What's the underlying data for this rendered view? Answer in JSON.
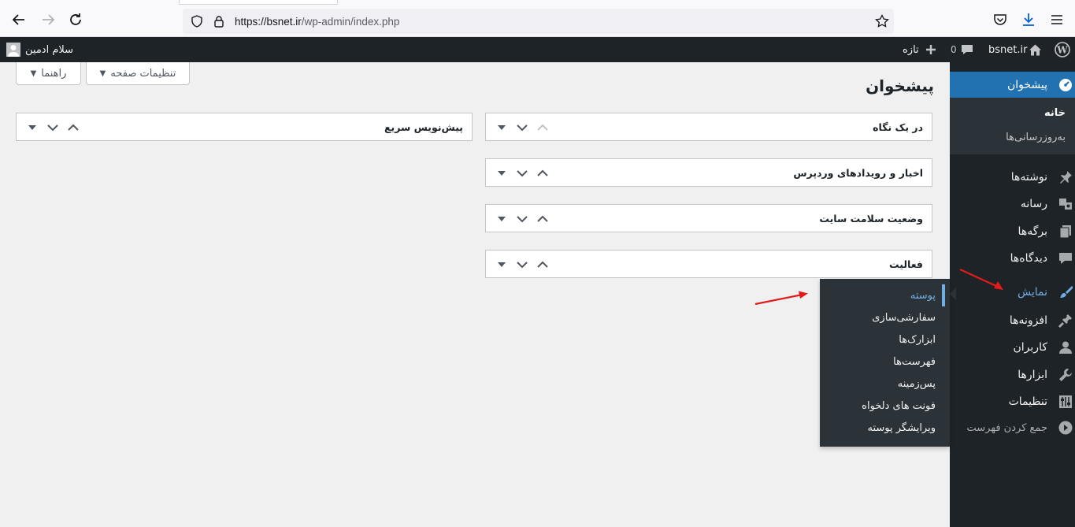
{
  "browser": {
    "url_host": "https://bsnet.ir",
    "url_path": "/wp-admin/index.php"
  },
  "adminbar": {
    "site_name": "bsnet.ir",
    "comments_count": "0",
    "new_label": "تازه",
    "greeting": "سلام ادمین"
  },
  "sidebar": {
    "dashboard_label": "پیشخوان",
    "home_label": "خانه",
    "updates_label": "به‌روزرسانی‌ها",
    "posts_label": "نوشته‌ها",
    "media_label": "رسانه",
    "pages_label": "برگه‌ها",
    "comments_label": "دیدگاه‌ها",
    "appearance_label": "نمایش",
    "plugins_label": "افزونه‌ها",
    "users_label": "کاربران",
    "tools_label": "ابزارها",
    "settings_label": "تنظیمات",
    "collapse_label": "جمع کردن فهرست"
  },
  "flyout": {
    "items": [
      "پوسته",
      "سفارشی‌سازی",
      "ابزارک‌ها",
      "فهرست‌ها",
      "پس‌زمینه",
      "فونت های دلخواه",
      "ویرایشگر پوسته"
    ]
  },
  "content": {
    "page_title": "پیشخوان",
    "screen_options_label": "تنظیمات صفحه",
    "help_label": "راهنما",
    "boxes": {
      "at_a_glance": "در یک نگاه",
      "quick_draft": "پیش‌نویس سریع",
      "news": "اخبار و رویدادهای وردپرس",
      "site_health": "وضعیت سلامت سایت",
      "activity": "فعالیت"
    }
  },
  "colors": {
    "admin_bar": "#1d2327",
    "sidebar": "#1d2327",
    "current_menu": "#2271b1",
    "submenu": "#2c3338",
    "highlight": "#72aee6",
    "annotation_arrow": "#e21b1b"
  }
}
